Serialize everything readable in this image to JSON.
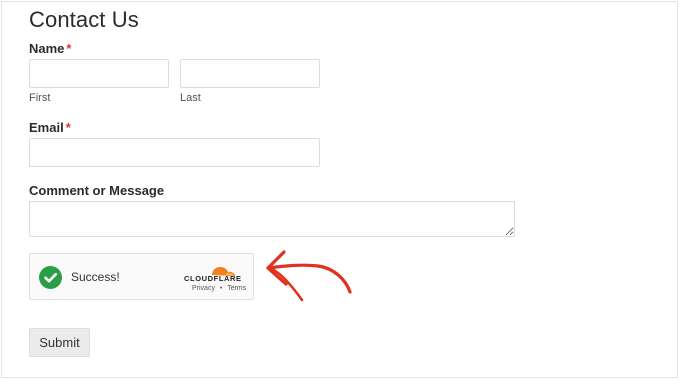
{
  "form": {
    "title": "Contact Us",
    "name": {
      "label": "Name",
      "required_mark": "*",
      "first_value": "",
      "first_sublabel": "First",
      "last_value": "",
      "last_sublabel": "Last"
    },
    "email": {
      "label": "Email",
      "required_mark": "*",
      "value": ""
    },
    "comment": {
      "label": "Comment or Message",
      "value": ""
    },
    "captcha": {
      "status_text": "Success!",
      "provider": "CLOUDFLARE",
      "privacy_link": "Privacy",
      "separator": "•",
      "terms_link": "Terms",
      "success_color": "#2a9d47",
      "brand_color": "#f38020"
    },
    "submit_label": "Submit"
  },
  "annotation": {
    "arrow_color": "#e0321e",
    "icon": "hand-drawn-arrow-icon"
  }
}
